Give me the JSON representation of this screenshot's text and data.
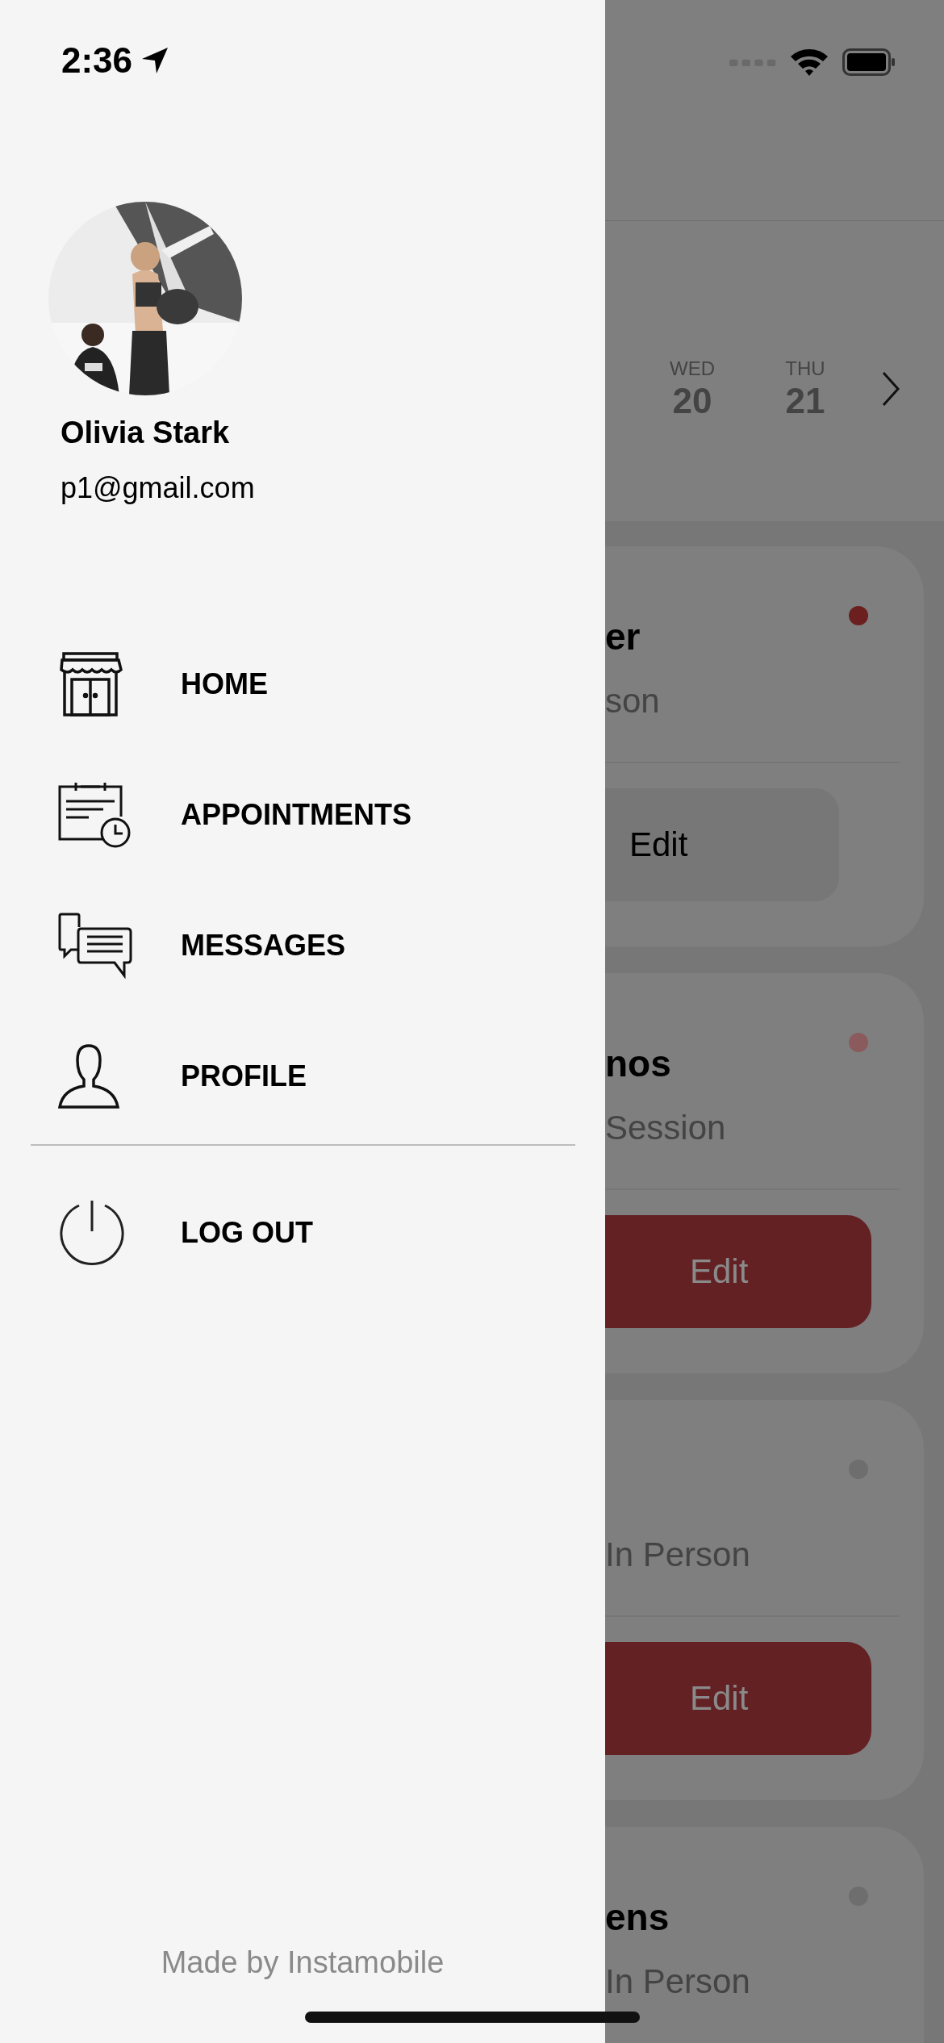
{
  "status_bar": {
    "time": "2:36"
  },
  "calendar": {
    "days": [
      {
        "weekday": "WED",
        "date": "20"
      },
      {
        "weekday": "THU",
        "date": "21"
      }
    ]
  },
  "appointments": [
    {
      "title": "er",
      "subtitle": "son",
      "color": "#6b1f1f",
      "button": {
        "label": "Edit",
        "kind": "plain"
      }
    },
    {
      "title": "nos",
      "subtitle": "Session",
      "color": "#8b5a5d",
      "button": {
        "label": "Edit",
        "kind": "primary"
      }
    },
    {
      "subtitle": "In Person",
      "color": "#6e6e6e",
      "button": {
        "label": "Edit",
        "kind": "primary"
      }
    },
    {
      "title": "ens",
      "subtitle": "In Person",
      "color": "#6e6e6e"
    }
  ],
  "drawer": {
    "profile": {
      "name": "Olivia Stark",
      "email": "p1@gmail.com"
    },
    "menu": [
      {
        "label": "HOME",
        "kind": "store"
      },
      {
        "label": "APPOINTMENTS",
        "kind": "calendar"
      },
      {
        "label": "MESSAGES",
        "kind": "chat"
      },
      {
        "label": "PROFILE",
        "kind": "person"
      }
    ],
    "logout": {
      "label": "LOG OUT",
      "kind": "power"
    },
    "footer": "Made by Instamobile"
  }
}
